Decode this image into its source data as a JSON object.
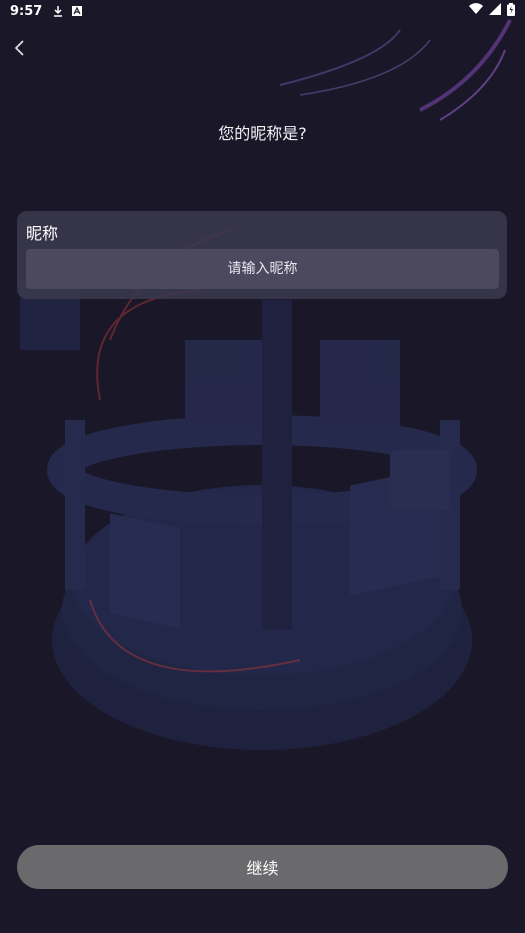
{
  "status_bar": {
    "time": "9:57",
    "left_icons": [
      "download-icon",
      "a-notification-icon"
    ],
    "right_icons": [
      "wifi-icon",
      "signal-icon",
      "battery-icon"
    ]
  },
  "header": {
    "back_icon": "chevron-left-icon",
    "title": "您的昵称是?"
  },
  "form": {
    "label": "昵称",
    "input_value": "",
    "input_placeholder": "请输入昵称"
  },
  "footer": {
    "continue_label": "继续"
  },
  "colors": {
    "background": "#1a1729",
    "card": "#3c394e",
    "input": "#4c485e",
    "button": "#6a6a6d",
    "accent_decor": "#b23a3a"
  }
}
